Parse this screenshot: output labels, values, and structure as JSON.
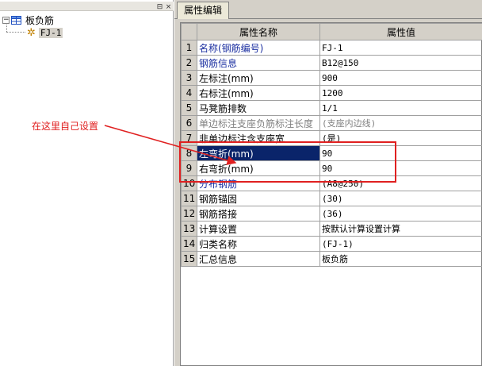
{
  "tree": {
    "root_label": "板负筋",
    "child_label": "FJ-1"
  },
  "tabs": [
    "属性编辑"
  ],
  "grid": {
    "headers": {
      "name": "属性名称",
      "value": "属性值"
    },
    "rows": [
      {
        "num": "1",
        "name": "名称(钢筋编号)",
        "value": "FJ-1",
        "style": "blue"
      },
      {
        "num": "2",
        "name": "钢筋信息",
        "value": "B12@150",
        "style": "blue"
      },
      {
        "num": "3",
        "name": "左标注(mm)",
        "value": "900",
        "style": ""
      },
      {
        "num": "4",
        "name": "右标注(mm)",
        "value": "1200",
        "style": ""
      },
      {
        "num": "5",
        "name": "马凳筋排数",
        "value": "1/1",
        "style": ""
      },
      {
        "num": "6",
        "name": "单边标注支座负筋标注长度",
        "value": "(支座内边线)",
        "style": "gray"
      },
      {
        "num": "7",
        "name": "非单边标注含支座宽",
        "value": "(是)",
        "style": ""
      },
      {
        "num": "8",
        "name": "左弯折(mm)",
        "value": "90",
        "style": "selected"
      },
      {
        "num": "9",
        "name": "右弯折(mm)",
        "value": "90",
        "style": ""
      },
      {
        "num": "10",
        "name": "分布钢筋",
        "value": "(A8@250)",
        "style": "blue"
      },
      {
        "num": "11",
        "name": "钢筋锚固",
        "value": "(30)",
        "style": ""
      },
      {
        "num": "12",
        "name": "钢筋搭接",
        "value": "(36)",
        "style": ""
      },
      {
        "num": "13",
        "name": "计算设置",
        "value": "按默认计算设置计算",
        "style": ""
      },
      {
        "num": "14",
        "name": "归类名称",
        "value": "(FJ-1)",
        "style": ""
      },
      {
        "num": "15",
        "name": "汇总信息",
        "value": "板负筋",
        "style": ""
      }
    ]
  },
  "annotation": {
    "text": "在这里自己设置",
    "color": "#e02020"
  },
  "icons": {
    "pin": "pin-icon",
    "close": "close-icon",
    "tree_table": "table-icon",
    "tree_leaf": "gear-icon"
  }
}
